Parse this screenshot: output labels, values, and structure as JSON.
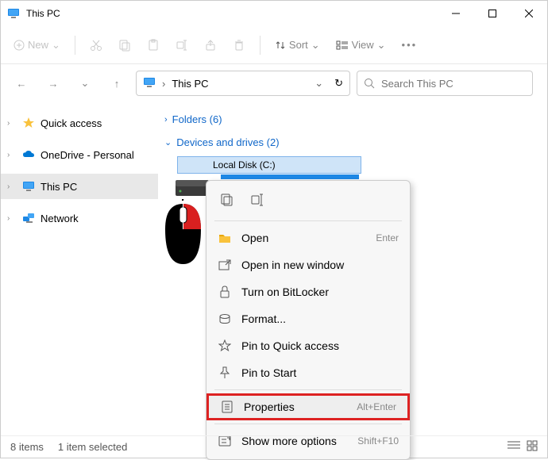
{
  "title": "This PC",
  "toolbar": {
    "new_label": "New",
    "sort_label": "Sort",
    "view_label": "View"
  },
  "address": {
    "path": "This PC"
  },
  "search": {
    "placeholder": "Search This PC"
  },
  "sidebar": {
    "items": [
      {
        "label": "Quick access"
      },
      {
        "label": "OneDrive - Personal"
      },
      {
        "label": "This PC"
      },
      {
        "label": "Network"
      }
    ]
  },
  "content": {
    "folders_header": "Folders (6)",
    "drives_header": "Devices and drives (2)",
    "disk_label": "Local Disk (C:)"
  },
  "context_menu": {
    "items": [
      {
        "label": "Open",
        "accel": "Enter"
      },
      {
        "label": "Open in new window",
        "accel": ""
      },
      {
        "label": "Turn on BitLocker",
        "accel": ""
      },
      {
        "label": "Format...",
        "accel": ""
      },
      {
        "label": "Pin to Quick access",
        "accel": ""
      },
      {
        "label": "Pin to Start",
        "accel": ""
      },
      {
        "label": "Properties",
        "accel": "Alt+Enter"
      },
      {
        "label": "Show more options",
        "accel": "Shift+F10"
      }
    ]
  },
  "statusbar": {
    "items_count": "8 items",
    "selected": "1 item selected"
  }
}
